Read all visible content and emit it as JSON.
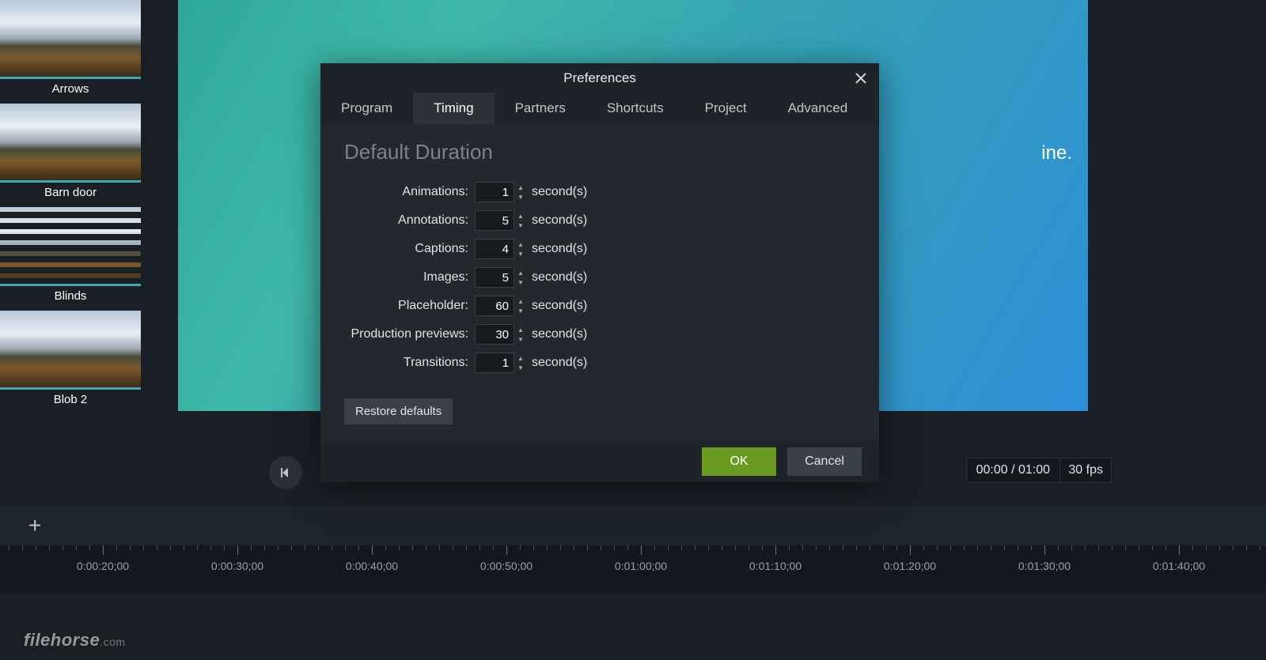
{
  "sidebar": {
    "items": [
      {
        "label": "Arrows"
      },
      {
        "label": "Barn door"
      },
      {
        "label": "Blinds"
      },
      {
        "label": "Blob 2"
      }
    ]
  },
  "preview": {
    "hint_text": "ine."
  },
  "playback": {
    "time_display": "00:00 / 01:00",
    "fps_display": "30 fps"
  },
  "timeline": {
    "ticks": [
      "0:00:20;00",
      "0:00:30;00",
      "0:00:40;00",
      "0:00:50;00",
      "0:01:00;00",
      "0:01:10;00",
      "0:01:20;00",
      "0:01:30;00",
      "0:01:40;00"
    ]
  },
  "dialog": {
    "title": "Preferences",
    "tabs": [
      "Program",
      "Timing",
      "Partners",
      "Shortcuts",
      "Project",
      "Advanced"
    ],
    "active_tab": "Timing",
    "section_title": "Default Duration",
    "unit": "second(s)",
    "rows": [
      {
        "label": "Animations:",
        "value": "1"
      },
      {
        "label": "Annotations:",
        "value": "5"
      },
      {
        "label": "Captions:",
        "value": "4"
      },
      {
        "label": "Images:",
        "value": "5"
      },
      {
        "label": "Placeholder:",
        "value": "60"
      },
      {
        "label": "Production previews:",
        "value": "30"
      },
      {
        "label": "Transitions:",
        "value": "1"
      }
    ],
    "restore": "Restore defaults",
    "ok": "OK",
    "cancel": "Cancel"
  },
  "brand": {
    "name": "filehorse",
    "tld": ".com"
  }
}
